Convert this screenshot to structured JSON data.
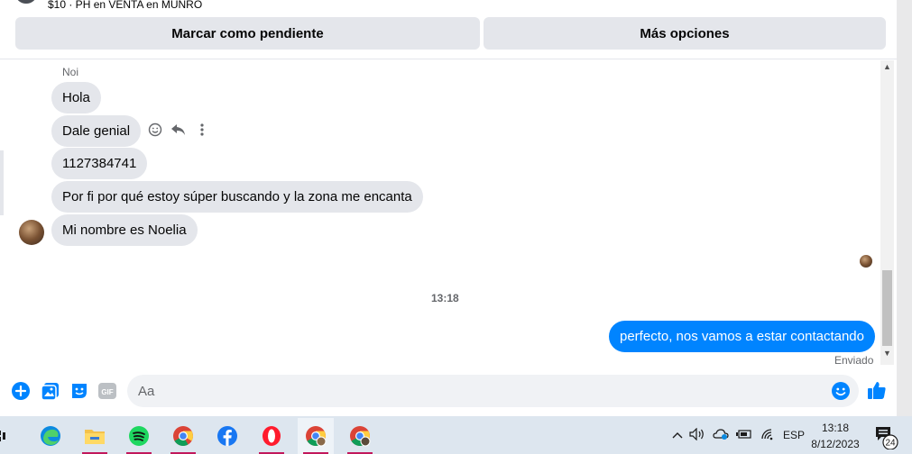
{
  "listing": {
    "subtitle": "$10 · PH en VENTA en MUNRO"
  },
  "actions": {
    "mark_pending": "Marcar como pendiente",
    "more_options": "Más opciones"
  },
  "chat": {
    "sender": "Noi",
    "incoming": [
      "Hola",
      "Dale genial",
      "1127384741",
      "Por fi por qué estoy súper buscando y la zona me encanta",
      "Mi nombre es Noelia"
    ],
    "timestamp": "13:18",
    "outgoing": "perfecto, nos vamos a estar contactando",
    "status": "Enviado"
  },
  "composer": {
    "placeholder": "Aa",
    "gif_label": "GIF"
  },
  "taskbar": {
    "language": "ESP",
    "time": "13:18",
    "date": "8/12/2023",
    "notifications": "24"
  },
  "colors": {
    "messenger_blue": "#0084ff",
    "bubble_gray": "#e4e6eb"
  }
}
